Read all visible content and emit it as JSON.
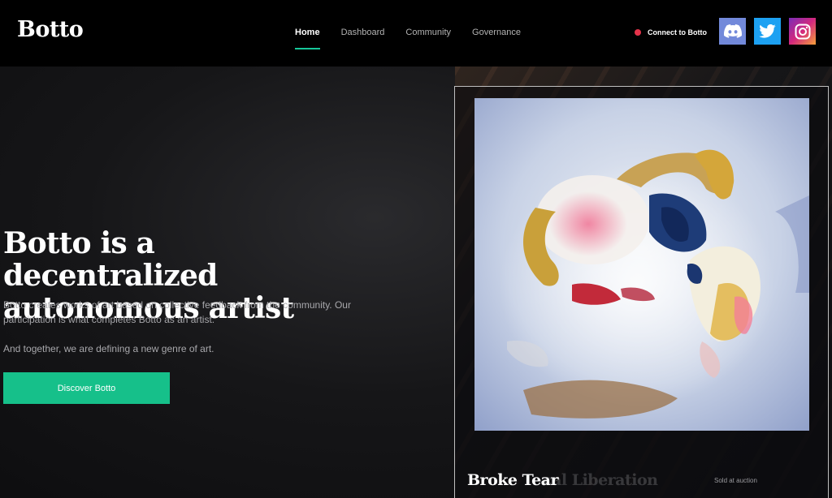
{
  "header": {
    "logo": "Botto",
    "nav": [
      {
        "label": "Home",
        "active": true
      },
      {
        "label": "Dashboard",
        "active": false
      },
      {
        "label": "Community",
        "active": false
      },
      {
        "label": "Governance",
        "active": false
      }
    ],
    "connect_label": "Connect to Botto",
    "social_icons": [
      "discord-icon",
      "twitter-icon",
      "instagram-icon"
    ]
  },
  "hero": {
    "headline": "Botto is a decentralized autonomous artist",
    "description": "Botto creates works of art based on collective feedback from the community. Our participation is what completes Botto as an artist.",
    "description2": "And together, we are defining a new genre of art.",
    "cta_label": "Discover Botto"
  },
  "featured": {
    "title": "Broke Tear",
    "next_title_fading": "cal Liberation",
    "status": "Sold at auction"
  },
  "colors": {
    "accent": "#16c08a",
    "connect_dot": "#e5334a",
    "discord": "#7289da",
    "twitter": "#1da1f2"
  }
}
